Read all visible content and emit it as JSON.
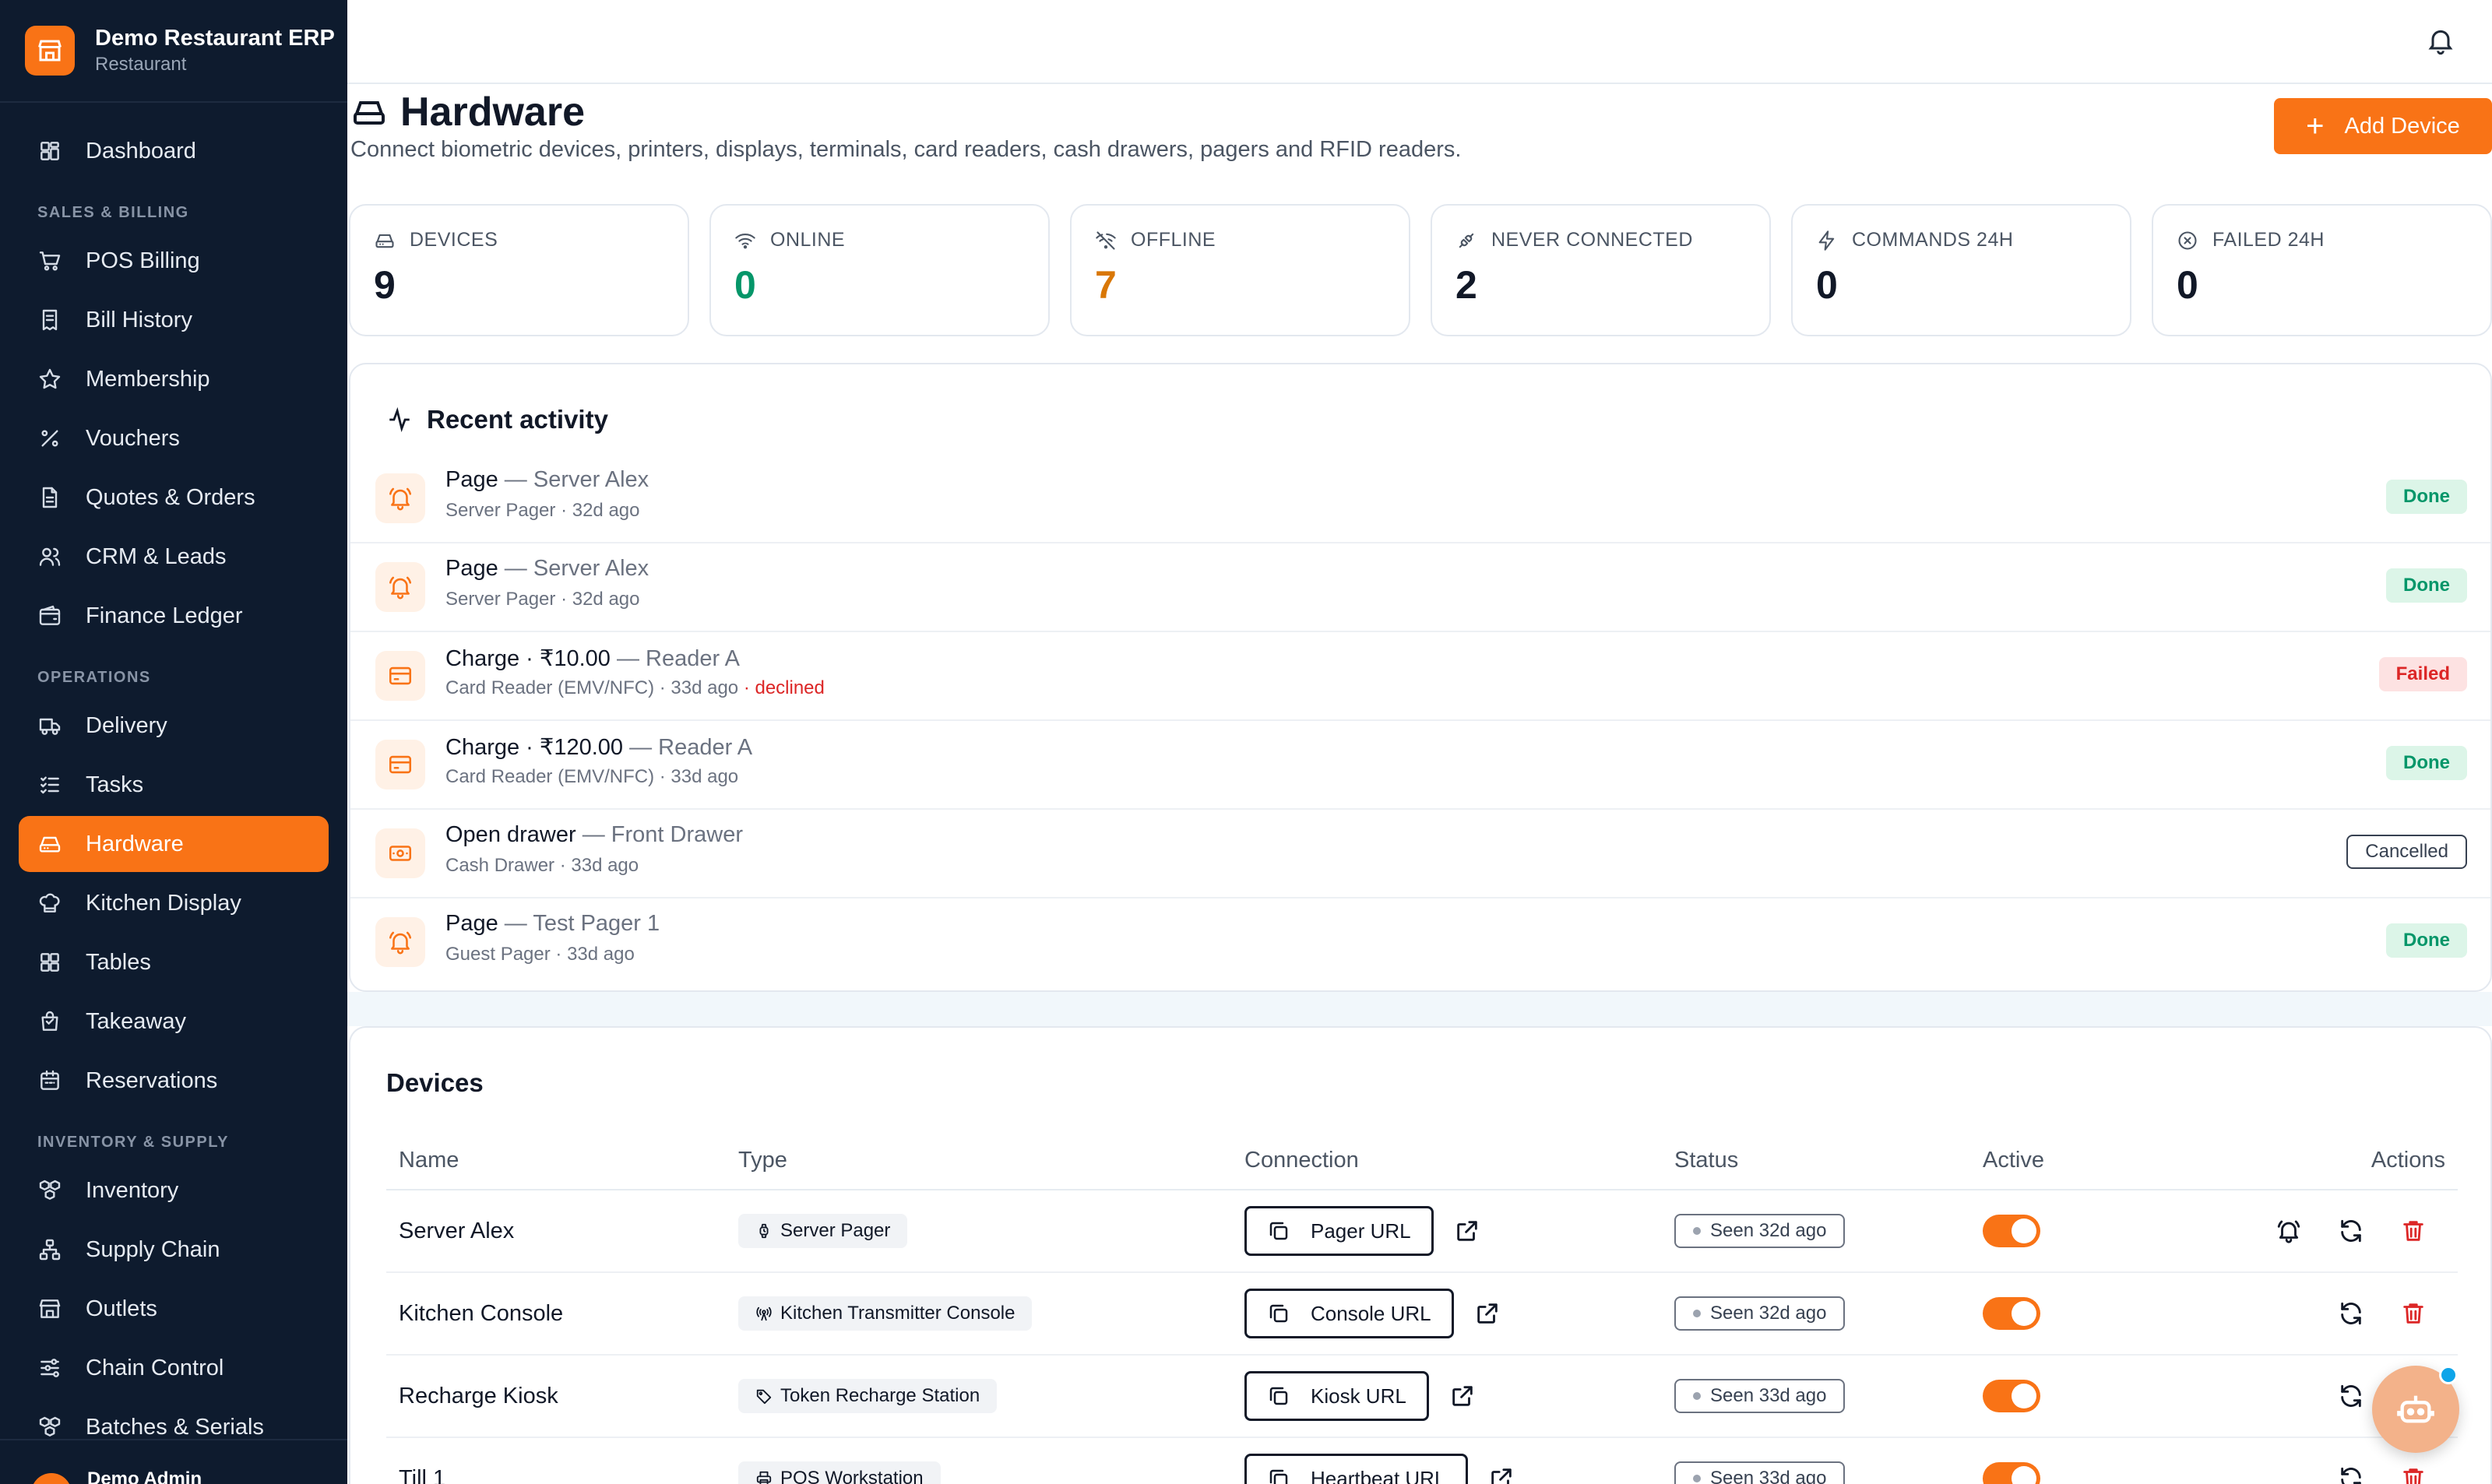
{
  "brand": {
    "name": "Demo Restaurant ERP",
    "subtitle": "Restaurant"
  },
  "sidebar": {
    "top_items": [
      {
        "label": "Dashboard",
        "icon": "dashboard-icon"
      }
    ],
    "sections": [
      {
        "title": "SALES & BILLING",
        "items": [
          {
            "label": "POS Billing",
            "icon": "cart-icon"
          },
          {
            "label": "Bill History",
            "icon": "receipt-icon"
          },
          {
            "label": "Membership",
            "icon": "star-icon"
          },
          {
            "label": "Vouchers",
            "icon": "percent-icon"
          },
          {
            "label": "Quotes & Orders",
            "icon": "document-icon"
          },
          {
            "label": "CRM & Leads",
            "icon": "users-icon"
          },
          {
            "label": "Finance Ledger",
            "icon": "wallet-icon"
          }
        ]
      },
      {
        "title": "OPERATIONS",
        "items": [
          {
            "label": "Delivery",
            "icon": "truck-icon"
          },
          {
            "label": "Tasks",
            "icon": "checklist-icon"
          },
          {
            "label": "Hardware",
            "icon": "hard-drive-icon",
            "active": true
          },
          {
            "label": "Kitchen Display",
            "icon": "chef-hat-icon"
          },
          {
            "label": "Tables",
            "icon": "grid-icon"
          },
          {
            "label": "Takeaway",
            "icon": "bag-icon"
          },
          {
            "label": "Reservations",
            "icon": "calendar-icon"
          }
        ]
      },
      {
        "title": "INVENTORY & SUPPLY",
        "items": [
          {
            "label": "Inventory",
            "icon": "boxes-icon"
          },
          {
            "label": "Supply Chain",
            "icon": "network-icon"
          },
          {
            "label": "Outlets",
            "icon": "store-icon"
          },
          {
            "label": "Chain Control",
            "icon": "sliders-icon"
          },
          {
            "label": "Batches & Serials",
            "icon": "boxes-icon"
          }
        ]
      }
    ],
    "footer_user": "Demo Admin"
  },
  "page": {
    "title": "Hardware",
    "subtitle": "Connect biometric devices, printers, displays, terminals, card readers, cash drawers, pagers and RFID readers.",
    "add_button": "Add Device"
  },
  "stats": [
    {
      "label": "DEVICES",
      "value": "9",
      "icon": "hard-drive-icon",
      "tone": ""
    },
    {
      "label": "ONLINE",
      "value": "0",
      "icon": "wifi-icon",
      "tone": "green"
    },
    {
      "label": "OFFLINE",
      "value": "7",
      "icon": "wifi-off-icon",
      "tone": "amber"
    },
    {
      "label": "NEVER CONNECTED",
      "value": "2",
      "icon": "unplugged-icon",
      "tone": ""
    },
    {
      "label": "COMMANDS 24H",
      "value": "0",
      "icon": "zap-icon",
      "tone": ""
    },
    {
      "label": "FAILED 24H",
      "value": "0",
      "icon": "x-circle-icon",
      "tone": ""
    }
  ],
  "activity": {
    "title": "Recent activity",
    "items": [
      {
        "icon": "bell-ring-icon",
        "action": "Page",
        "device": "Server Alex",
        "meta": "Server Pager · 32d ago",
        "error": "",
        "status": "Done",
        "tone": "done"
      },
      {
        "icon": "bell-ring-icon",
        "action": "Page",
        "device": "Server Alex",
        "meta": "Server Pager · 32d ago",
        "error": "",
        "status": "Done",
        "tone": "done"
      },
      {
        "icon": "credit-card-icon",
        "action": "Charge · ₹10.00",
        "device": "Reader A",
        "meta": "Card Reader (EMV/NFC) · 33d ago",
        "error": "· declined",
        "status": "Failed",
        "tone": "failed"
      },
      {
        "icon": "credit-card-icon",
        "action": "Charge · ₹120.00",
        "device": "Reader A",
        "meta": "Card Reader (EMV/NFC) · 33d ago",
        "error": "",
        "status": "Done",
        "tone": "done"
      },
      {
        "icon": "cash-drawer-icon",
        "action": "Open drawer",
        "device": "Front Drawer",
        "meta": "Cash Drawer · 33d ago",
        "error": "",
        "status": "Cancelled",
        "tone": "cancelled"
      },
      {
        "icon": "bell-ring-icon",
        "action": "Page",
        "device": "Test Pager 1",
        "meta": "Guest Pager · 33d ago",
        "error": "",
        "status": "Done",
        "tone": "done"
      }
    ]
  },
  "devices": {
    "title": "Devices",
    "columns": [
      "Name",
      "Type",
      "Connection",
      "Status",
      "Active",
      "Actions"
    ],
    "rows": [
      {
        "name": "Server Alex",
        "type": "Server Pager",
        "type_icon": "watch-icon",
        "connection": "Pager URL",
        "status": "Seen 32d ago",
        "active": true,
        "actions": [
          "bell-ring-icon",
          "refresh-icon",
          "trash-icon"
        ]
      },
      {
        "name": "Kitchen Console",
        "type": "Kitchen Transmitter Console",
        "type_icon": "radio-tower-icon",
        "connection": "Console URL",
        "status": "Seen 32d ago",
        "active": true,
        "actions": [
          "refresh-icon",
          "trash-icon"
        ]
      },
      {
        "name": "Recharge Kiosk",
        "type": "Token Recharge Station",
        "type_icon": "tag-icon",
        "connection": "Kiosk URL",
        "status": "Seen 33d ago",
        "active": true,
        "actions": [
          "refresh-icon",
          "trash-icon"
        ]
      },
      {
        "name": "Till 1",
        "type": "POS Workstation",
        "type_icon": "printer-icon",
        "connection": "Heartbeat URL",
        "status": "Seen 33d ago",
        "active": true,
        "actions": [
          "refresh-icon",
          "trash-icon"
        ]
      }
    ]
  },
  "colors": {
    "accent": "#f97316",
    "sidebar_bg": "#0e1b2e",
    "success": "#059669",
    "warning": "#d97706",
    "danger": "#dc2626"
  }
}
